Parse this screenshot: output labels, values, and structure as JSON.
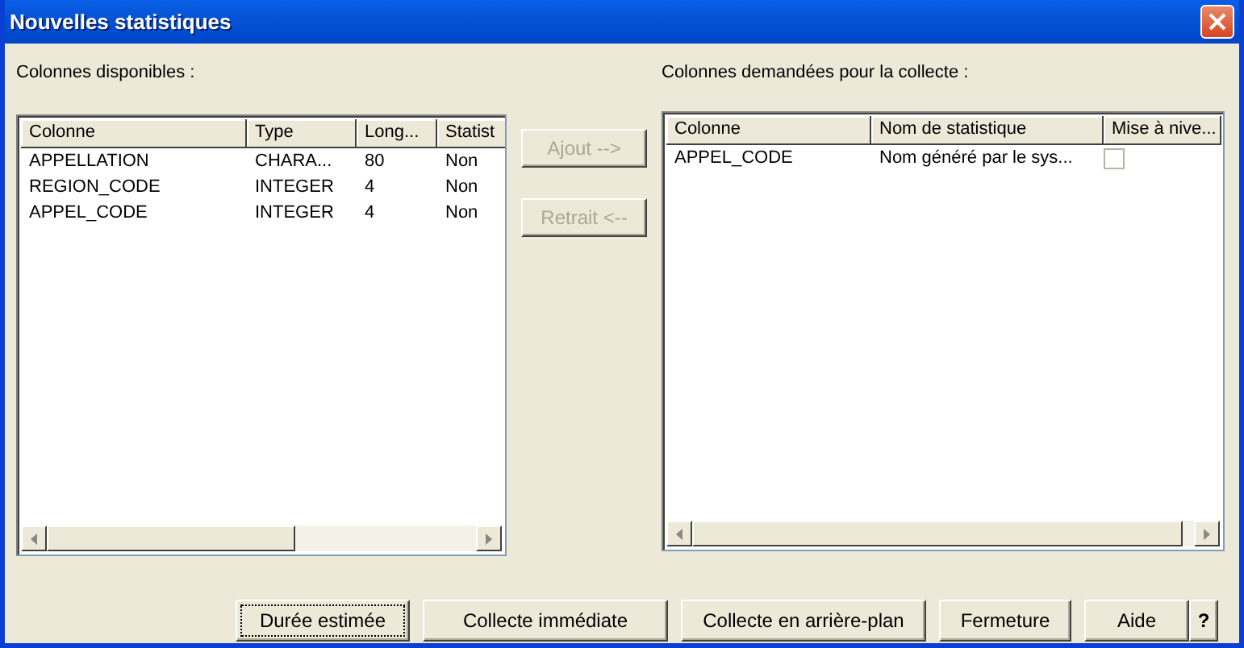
{
  "window": {
    "title": "Nouvelles statistiques"
  },
  "available": {
    "label": "Colonnes disponibles :",
    "columns": [
      "Colonne",
      "Type",
      "Long...",
      "Statist"
    ],
    "rows": [
      [
        "APPELLATION",
        "CHARA...",
        "80",
        "Non"
      ],
      [
        "REGION_CODE",
        "INTEGER",
        "4",
        "Non"
      ],
      [
        "APPEL_CODE",
        "INTEGER",
        "4",
        "Non"
      ]
    ]
  },
  "transfer_buttons": [
    {
      "label": "Ajout -->",
      "disabled": true
    },
    {
      "label": "Retrait <--",
      "disabled": true
    }
  ],
  "requested": {
    "label": "Colonnes demandées pour la collecte :",
    "columns": [
      "Colonne",
      "Nom de statistique",
      "Mise à nive..."
    ],
    "rows": [
      {
        "cells": [
          "APPEL_CODE",
          "Nom généré par le sys..."
        ],
        "checked": false
      }
    ]
  },
  "buttons": [
    {
      "label": "Durée estimée",
      "focused": true
    },
    {
      "label": "Collecte immédiate",
      "focused": false
    },
    {
      "label": "Collecte en arrière-plan",
      "focused": false
    },
    {
      "label": "Fermeture",
      "focused": false
    },
    {
      "label": "Aide",
      "focused": false
    },
    {
      "label": "?",
      "focused": false
    }
  ]
}
